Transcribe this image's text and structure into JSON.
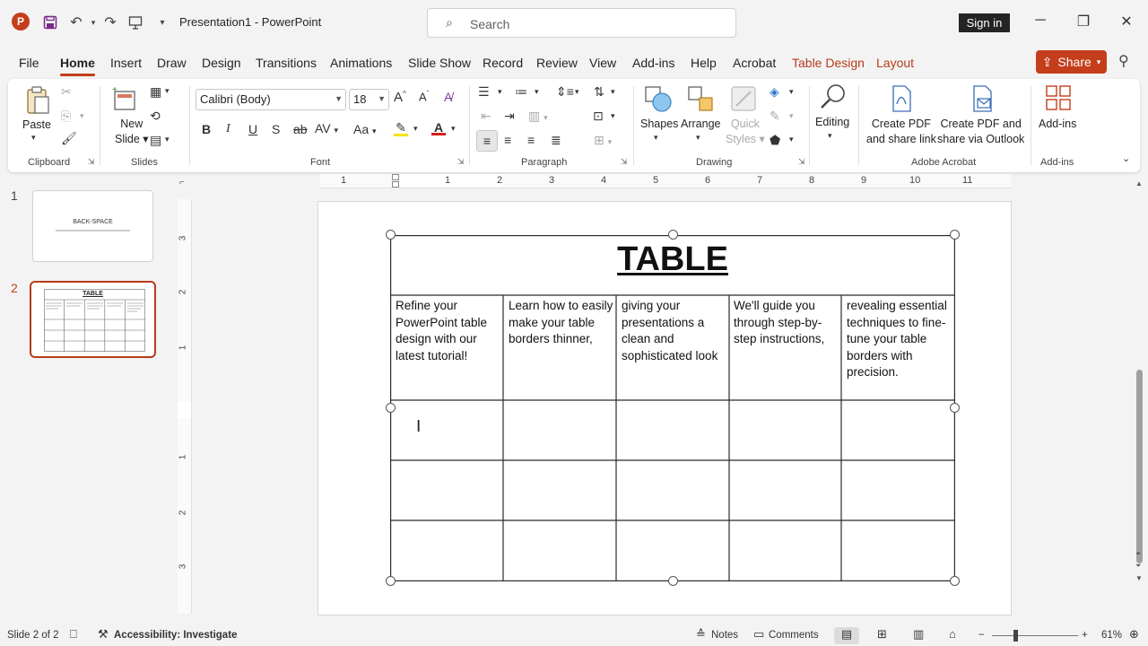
{
  "titlebar": {
    "app_logo": "P",
    "doc_title": "Presentation1  -  PowerPoint",
    "search_placeholder": "Search",
    "signin_label": "Sign in",
    "icons": [
      "save-icon",
      "undo-icon",
      "redo-icon",
      "present-icon",
      "customize-icon"
    ]
  },
  "menu": {
    "tabs": [
      "File",
      "Home",
      "Insert",
      "Draw",
      "Design",
      "Transitions",
      "Animations",
      "Slide Show",
      "Record",
      "Review",
      "View",
      "Add-ins",
      "Help",
      "Acrobat",
      "Table Design",
      "Layout"
    ],
    "active_tab": "Home",
    "share_label": "Share"
  },
  "ribbon": {
    "clipboard": {
      "label": "Clipboard",
      "paste": "Paste"
    },
    "slides": {
      "label": "Slides",
      "new_slide_1": "New",
      "new_slide_2": "Slide"
    },
    "font": {
      "label": "Font",
      "font_name": "Calibri (Body)",
      "font_size": "18",
      "bold": "B",
      "italic": "I",
      "underline": "U",
      "strike": "S",
      "case": "Aa"
    },
    "paragraph": {
      "label": "Paragraph"
    },
    "drawing": {
      "label": "Drawing",
      "shapes": "Shapes",
      "arrange": "Arrange",
      "quick_styles_1": "Quick",
      "quick_styles_2": "Styles"
    },
    "editing": {
      "label": "Editing"
    },
    "acrobat": {
      "label": "Adobe Acrobat",
      "create_pdf_1": "Create PDF",
      "create_pdf_2": "and share link",
      "create_outlook_1": "Create PDF and",
      "create_outlook_2": "share via Outlook"
    },
    "addins": {
      "label": "Add-ins",
      "addins_btn": "Add-ins"
    }
  },
  "slides_panel": {
    "slides": [
      {
        "num": "1",
        "title": "BACK-SPACE"
      },
      {
        "num": "2",
        "title": "TABLE"
      }
    ]
  },
  "ruler": {
    "h_ticks": [
      "1",
      "1",
      "2",
      "3",
      "4",
      "5",
      "6",
      "7",
      "8",
      "9",
      "10",
      "11"
    ],
    "v_ticks": [
      "3",
      "2",
      "1",
      "1",
      "2",
      "3"
    ]
  },
  "slide": {
    "title": "TABLE",
    "cells": [
      "Refine your PowerPoint table design with our latest tutorial!",
      "Learn how to easily make your table borders thinner,",
      "giving your presentations a clean and sophisticated look",
      "We'll guide you through step-by-step instructions,",
      "revealing essential techniques to fine-tune your table borders with precision."
    ]
  },
  "statusbar": {
    "slide_info": "Slide 2 of 2",
    "accessibility": "Accessibility: Investigate",
    "notes": "Notes",
    "comments": "Comments",
    "zoom": "61%"
  },
  "colors": {
    "accent": "#c43e1c",
    "context_tab": "#b83b1b"
  }
}
